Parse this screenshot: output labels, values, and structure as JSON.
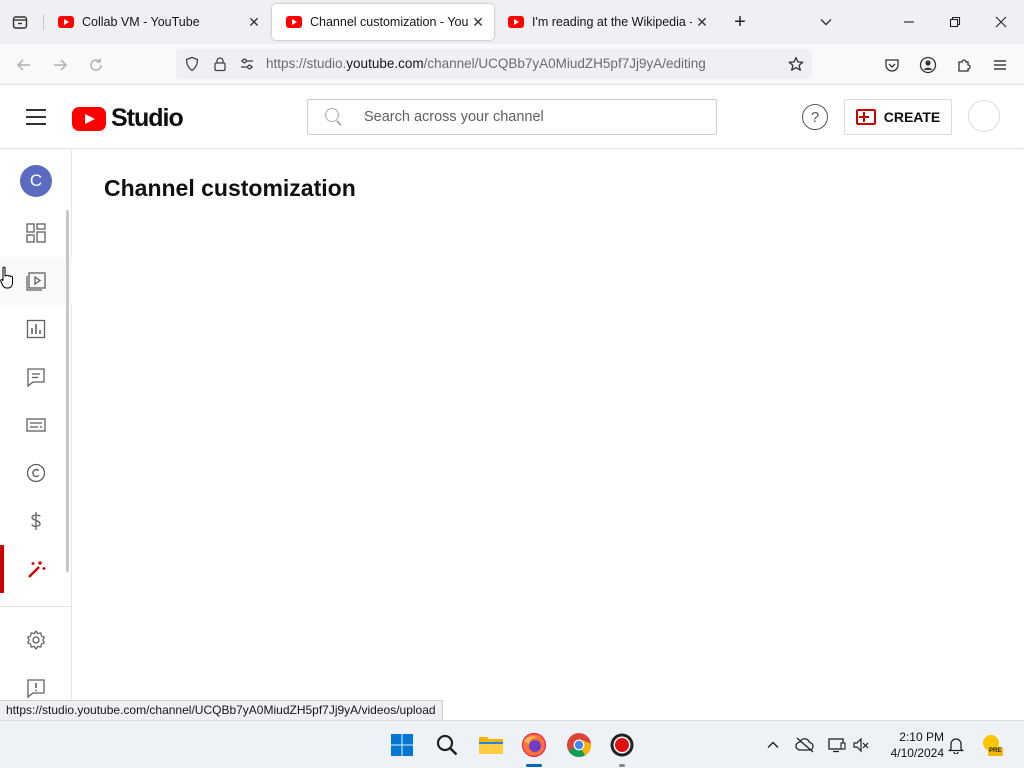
{
  "browser": {
    "tabs": [
      {
        "title": "Collab VM - YouTube",
        "active": false
      },
      {
        "title": "Channel customization - YouTube Studio",
        "active": true
      },
      {
        "title": "I'm reading at the Wikipedia - YouTube",
        "active": false
      }
    ],
    "url": {
      "prefix": "https://studio.",
      "host": "youtube.com",
      "path": "/channel/UCQBb7yA0MiudZH5pf7Jj9yA/editing"
    },
    "status_url": "https://studio.youtube.com/channel/UCQBb7yA0MiudZH5pf7Jj9yA/videos/upload"
  },
  "header": {
    "logo_text": "Studio",
    "search_placeholder": "Search across your channel",
    "help_glyph": "?",
    "create_label": "CREATE"
  },
  "sidebar": {
    "channel_initial": "C",
    "items": [
      {
        "name": "dashboard",
        "icon": "dashboard-icon"
      },
      {
        "name": "content",
        "icon": "content-icon"
      },
      {
        "name": "analytics",
        "icon": "analytics-icon"
      },
      {
        "name": "comments",
        "icon": "comments-icon"
      },
      {
        "name": "subtitles",
        "icon": "subtitles-icon"
      },
      {
        "name": "copyright",
        "icon": "copyright-icon"
      },
      {
        "name": "earn",
        "icon": "dollar-icon"
      },
      {
        "name": "customization",
        "icon": "magic-wand-icon",
        "selected": true
      },
      {
        "name": "settings",
        "icon": "gear-icon"
      },
      {
        "name": "send-feedback",
        "icon": "feedback-icon"
      }
    ]
  },
  "main": {
    "page_title": "Channel customization"
  },
  "taskbar": {
    "apps": [
      "windows-start",
      "search",
      "file-explorer",
      "firefox",
      "chrome",
      "recorder"
    ],
    "time": "2:10 PM",
    "date": "4/10/2024",
    "weather_badge": "PRE"
  },
  "colors": {
    "youtube_red": "#ff0000",
    "selected_indicator": "#cc0000",
    "channel_avatar": "#5c6bc0"
  }
}
